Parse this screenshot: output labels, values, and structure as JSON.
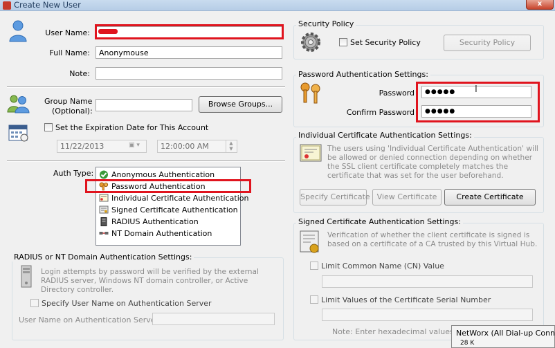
{
  "window": {
    "title": "Create New User",
    "close_glyph": "x"
  },
  "user": {
    "username_label": "User Name:",
    "username_value": "",
    "fullname_label": "Full Name:",
    "fullname_value": "Anonymouse",
    "note_label": "Note:",
    "note_value": ""
  },
  "group": {
    "label_line1": "Group Name",
    "label_line2": "(Optional):",
    "value": "",
    "browse_label": "Browse Groups..."
  },
  "expiration": {
    "checkbox_label": "Set the Expiration Date for This Account",
    "date_value": "11/22/2013",
    "time_value": "12:00:00 AM"
  },
  "auth": {
    "label": "Auth Type:",
    "selected": "Password Authentication",
    "options": [
      {
        "label": "Anonymous Authentication",
        "icon": "check-icon"
      },
      {
        "label": "Password Authentication",
        "icon": "keys-icon"
      },
      {
        "label": "Individual Certificate Authentication",
        "icon": "certificate-icon"
      },
      {
        "label": "Signed Certificate Authentication",
        "icon": "signed-certificate-icon"
      },
      {
        "label": "RADIUS Authentication",
        "icon": "server-icon"
      },
      {
        "label": "NT Domain Authentication",
        "icon": "network-icon"
      }
    ]
  },
  "radius": {
    "title": "RADIUS or NT Domain Authentication Settings:",
    "description": "Login attempts by password will be verified by the external RADIUS server, Windows NT domain controller, or Active Directory controller.",
    "specify_label": "Specify User Name on Authentication Server",
    "server_user_label": "User Name on Authentication Server:",
    "server_user_value": ""
  },
  "security_policy": {
    "title": "Security Policy",
    "checkbox_label": "Set Security Policy",
    "button_label": "Security Policy"
  },
  "password": {
    "title": "Password Authentication Settings:",
    "password_label": "Password",
    "password_value": "●●●●●",
    "confirm_label": "Confirm Password",
    "confirm_value": "●●●●●"
  },
  "individual_cert": {
    "title": "Individual Certificate Authentication Settings:",
    "description": "The users using 'Individual Certificate Authentication' will be allowed or denied connection depending on whether the SSL client certificate completely matches the certificate that was set for the user beforehand.",
    "specify_label": "Specify Certificate",
    "view_label": "View Certificate",
    "create_label": "Create Certificate"
  },
  "signed_cert": {
    "title": "Signed Certificate Authentication Settings:",
    "description": "Verification of whether the client certificate is signed is based on a certificate of a CA trusted by this Virtual Hub.",
    "cn_label": "Limit Common Name (CN) Value",
    "cn_value": "",
    "serial_label": "Limit Values of the Certificate Serial Number",
    "serial_value": "",
    "note": "Note: Enter hexadecimal values. (E"
  },
  "overlay": {
    "line1": "NetWorx (All Dial-up Conn",
    "line2": "28 K"
  }
}
